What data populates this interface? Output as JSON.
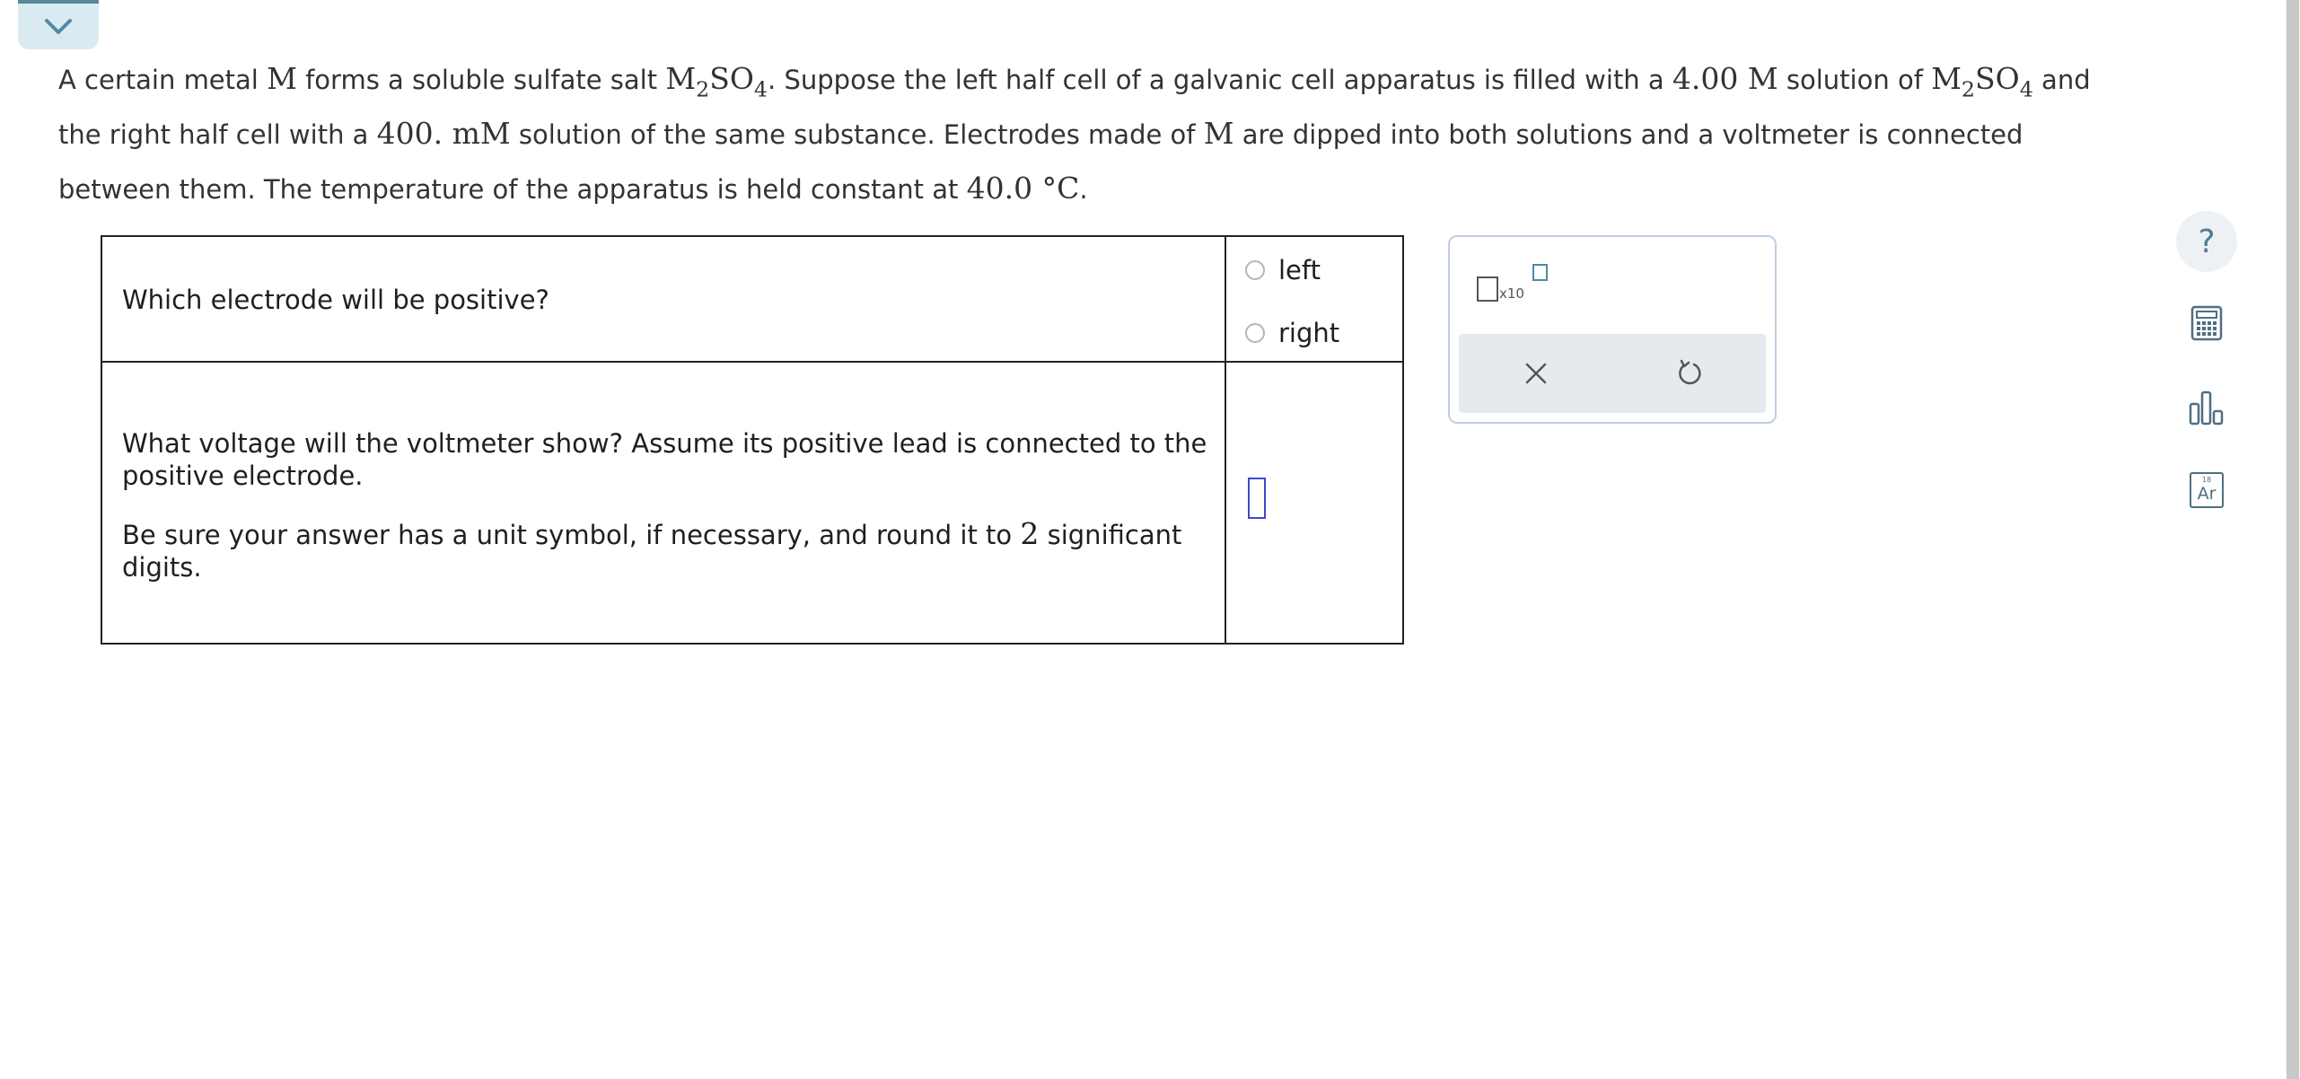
{
  "problem": {
    "seg1": "A certain metal ",
    "metal_symbol": "M",
    "seg2": " forms a soluble sulfate salt ",
    "salt_a": "M",
    "salt_sub2": "2",
    "salt_b": "SO",
    "salt_sub4": "4",
    "seg3": ". Suppose the left half cell of a galvanic cell apparatus is filled with a ",
    "left_conc": "4.00 M",
    "seg4": " solution of ",
    "seg5": " and the right half cell with a ",
    "right_conc": "400. mM",
    "seg6": " solution of the same substance. Electrodes made of ",
    "seg7": " are dipped into both solutions and a voltmeter is connected between them. The temperature of the apparatus is held constant at ",
    "temperature": "40.0 °C",
    "seg8": "."
  },
  "questions": {
    "q1": {
      "text": "Which electrode will be positive?",
      "options": [
        "left",
        "right"
      ]
    },
    "q2": {
      "text": "What voltage will the voltmeter show? Assume its positive lead is connected to the positive electrode.",
      "instruction_pre": "Be sure your answer has a unit symbol, if necessary, and round it to ",
      "sig_figs": "2",
      "instruction_post": " significant digits.",
      "answer_value": ""
    }
  },
  "tool_panel": {
    "sci_notation_label": "x10",
    "clear_icon": "close-icon",
    "undo_icon": "undo-icon"
  },
  "sidebar_tools": {
    "help_label": "?",
    "calculator_icon": "calculator-icon",
    "chart_icon": "bar-chart-icon",
    "periodic_table": {
      "atomic_number": "18",
      "symbol": "Ar"
    }
  },
  "colors": {
    "accent": "#56899b",
    "answer_box": "#3f48cc",
    "tool_panel_border": "#bfcfe0",
    "action_bar": "#e6eaee"
  }
}
